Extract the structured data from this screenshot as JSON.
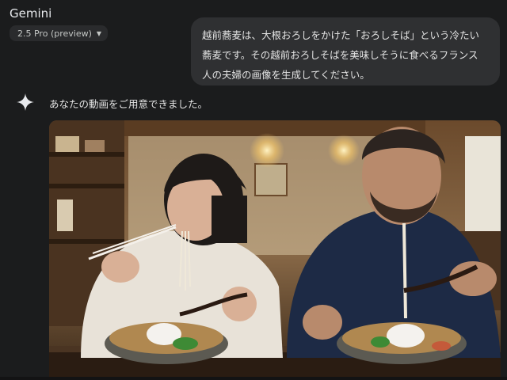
{
  "app": {
    "title": "Gemini",
    "model_label": "2.5 Pro (preview)"
  },
  "chat": {
    "user_message_lines": [
      "越前蕎麦は、大根おろしをかけた「おろしそば」という冷たい",
      "蕎麦です。その越前おろしそばを美味しそうに食べるフランス",
      "人の夫婦の画像を生成してください。"
    ],
    "response_text": "あなたの動画をご用意できました。"
  },
  "icons": {
    "model_caret": "chevron-down-icon",
    "response": "sparkle-icon"
  },
  "colors": {
    "background": "#1b1c1d",
    "bubble": "#2f3032",
    "model_chip": "#2a2b2d"
  }
}
